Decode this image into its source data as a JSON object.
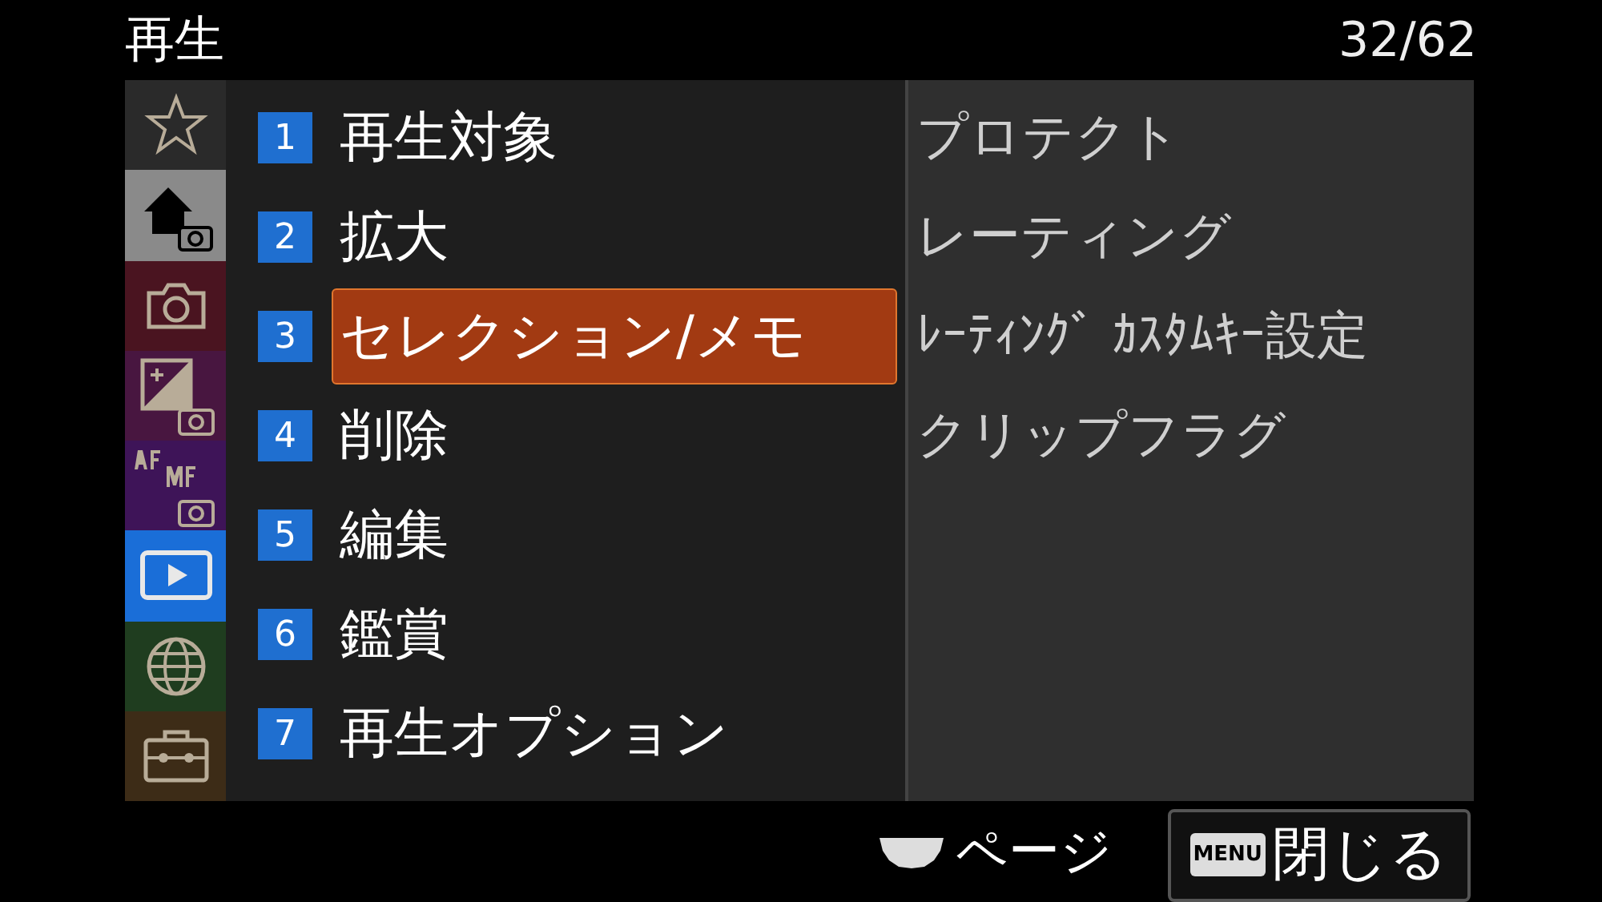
{
  "header": {
    "title": "再生",
    "page": "32/62"
  },
  "sidebar": {
    "tabs": [
      {
        "kind": "star",
        "color": "#2a2a2a",
        "selected": false
      },
      {
        "kind": "home",
        "color": "#8a8a8a",
        "selected": false
      },
      {
        "kind": "camera",
        "color": "#4a1420",
        "selected": false
      },
      {
        "kind": "exposure",
        "color": "#481640",
        "selected": false
      },
      {
        "kind": "afmf",
        "color": "#3e1458",
        "selected": false
      },
      {
        "kind": "playback",
        "color": "#1a6ed8",
        "selected": true
      },
      {
        "kind": "globe",
        "color": "#1f3d1f",
        "selected": false
      },
      {
        "kind": "toolbox",
        "color": "#3d2c17",
        "selected": false
      }
    ]
  },
  "menu": {
    "items": [
      {
        "number": "1",
        "label": "再生対象",
        "selected": false
      },
      {
        "number": "2",
        "label": "拡大",
        "selected": false
      },
      {
        "number": "3",
        "label": "セレクション/メモ",
        "selected": true
      },
      {
        "number": "4",
        "label": "削除",
        "selected": false
      },
      {
        "number": "5",
        "label": "編集",
        "selected": false
      },
      {
        "number": "6",
        "label": "鑑賞",
        "selected": false
      },
      {
        "number": "7",
        "label": "再生オプション",
        "selected": false
      }
    ]
  },
  "submenu": {
    "items": [
      "プロテクト",
      "レーティング",
      "ﾚｰﾃｨﾝｸﾞ ｶｽﾀﾑｷｰ設定",
      "クリップフラグ"
    ]
  },
  "footer": {
    "page_hint": "ページ",
    "close_key": "MENU",
    "close_label": "閉じる"
  }
}
